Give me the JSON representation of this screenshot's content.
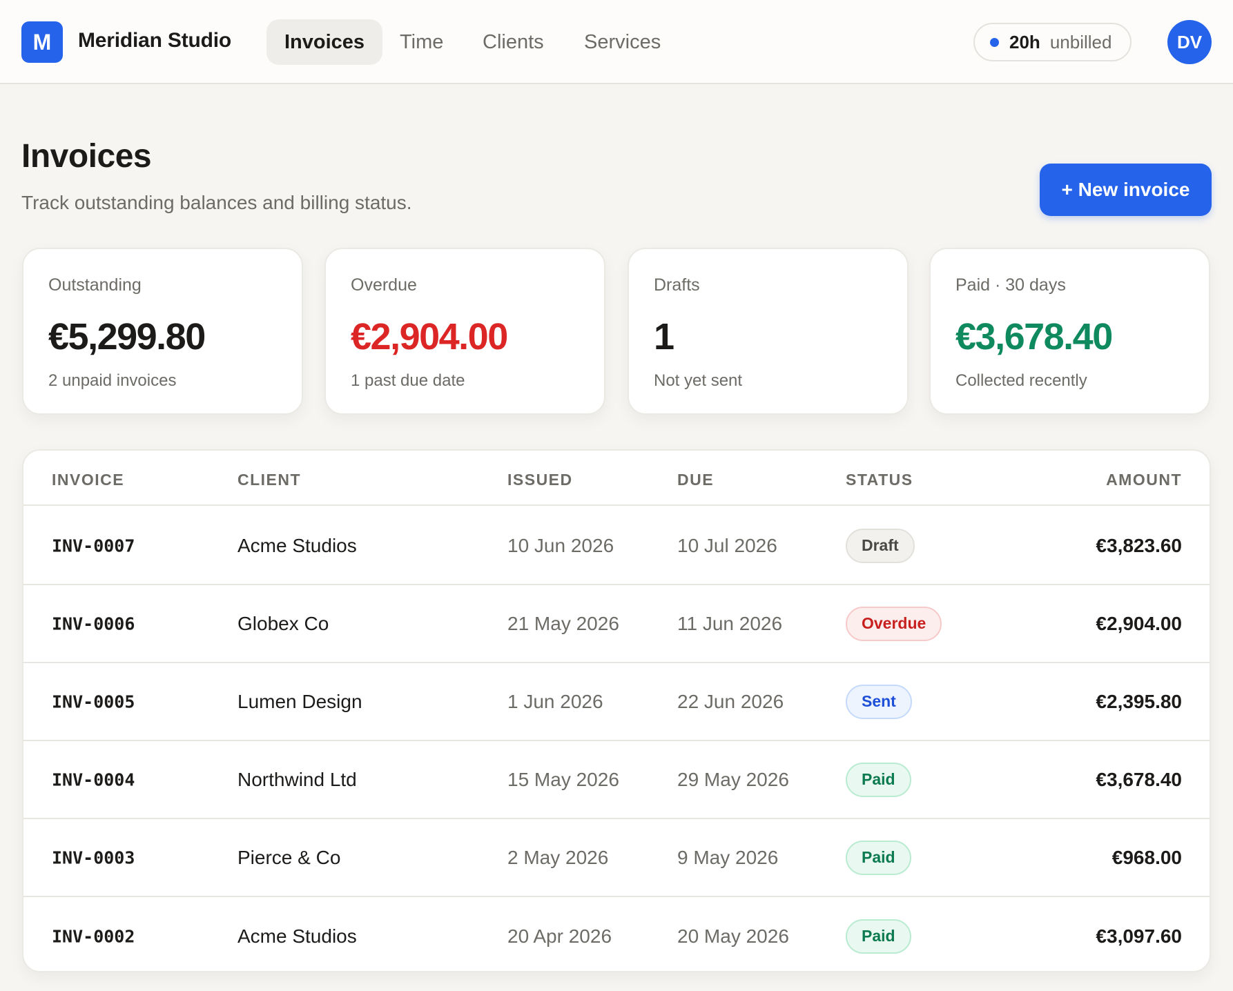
{
  "app": {
    "brand_letter": "M",
    "brand_name": "Meridian Studio",
    "brand_color": "#2563eb"
  },
  "nav": {
    "tabs": [
      {
        "label": "Invoices",
        "active": true
      },
      {
        "label": "Time",
        "active": false
      },
      {
        "label": "Clients",
        "active": false
      },
      {
        "label": "Services",
        "active": false
      }
    ]
  },
  "header": {
    "unbilled_hours": "20h",
    "unbilled_label": "unbilled",
    "avatar_initials": "DV"
  },
  "page": {
    "title": "Invoices",
    "subtitle": "Track outstanding balances and billing status.",
    "new_invoice_label": "+ New invoice"
  },
  "stats": [
    {
      "label": "Outstanding",
      "value": "€5,299.80",
      "note": "2 unpaid invoices",
      "tone": "default"
    },
    {
      "label": "Overdue",
      "value": "€2,904.00",
      "note": "1 past due date",
      "tone": "red"
    },
    {
      "label": "Drafts",
      "value": "1",
      "note": "Not yet sent",
      "tone": "default"
    },
    {
      "label": "Paid · 30 days",
      "value": "€3,678.40",
      "note": "Collected recently",
      "tone": "green"
    }
  ],
  "table": {
    "columns": [
      "INVOICE",
      "CLIENT",
      "ISSUED",
      "DUE",
      "STATUS",
      "AMOUNT"
    ],
    "rows": [
      {
        "invoice": "INV-0007",
        "client": "Acme Studios",
        "issued": "10 Jun 2026",
        "due": "10 Jul 2026",
        "status": "Draft",
        "amount": "€3,823.60"
      },
      {
        "invoice": "INV-0006",
        "client": "Globex Co",
        "issued": "21 May 2026",
        "due": "11 Jun 2026",
        "status": "Overdue",
        "amount": "€2,904.00"
      },
      {
        "invoice": "INV-0005",
        "client": "Lumen Design",
        "issued": "1 Jun 2026",
        "due": "22 Jun 2026",
        "status": "Sent",
        "amount": "€2,395.80"
      },
      {
        "invoice": "INV-0004",
        "client": "Northwind Ltd",
        "issued": "15 May 2026",
        "due": "29 May 2026",
        "status": "Paid",
        "amount": "€3,678.40"
      },
      {
        "invoice": "INV-0003",
        "client": "Pierce & Co",
        "issued": "2 May 2026",
        "due": "9 May 2026",
        "status": "Paid",
        "amount": "€968.00"
      },
      {
        "invoice": "INV-0002",
        "client": "Acme Studios",
        "issued": "20 Apr 2026",
        "due": "20 May 2026",
        "status": "Paid",
        "amount": "€3,097.60"
      }
    ]
  },
  "colors": {
    "accent": "#2563eb",
    "overdue": "#dc2626",
    "paid": "#0f8a5f"
  }
}
